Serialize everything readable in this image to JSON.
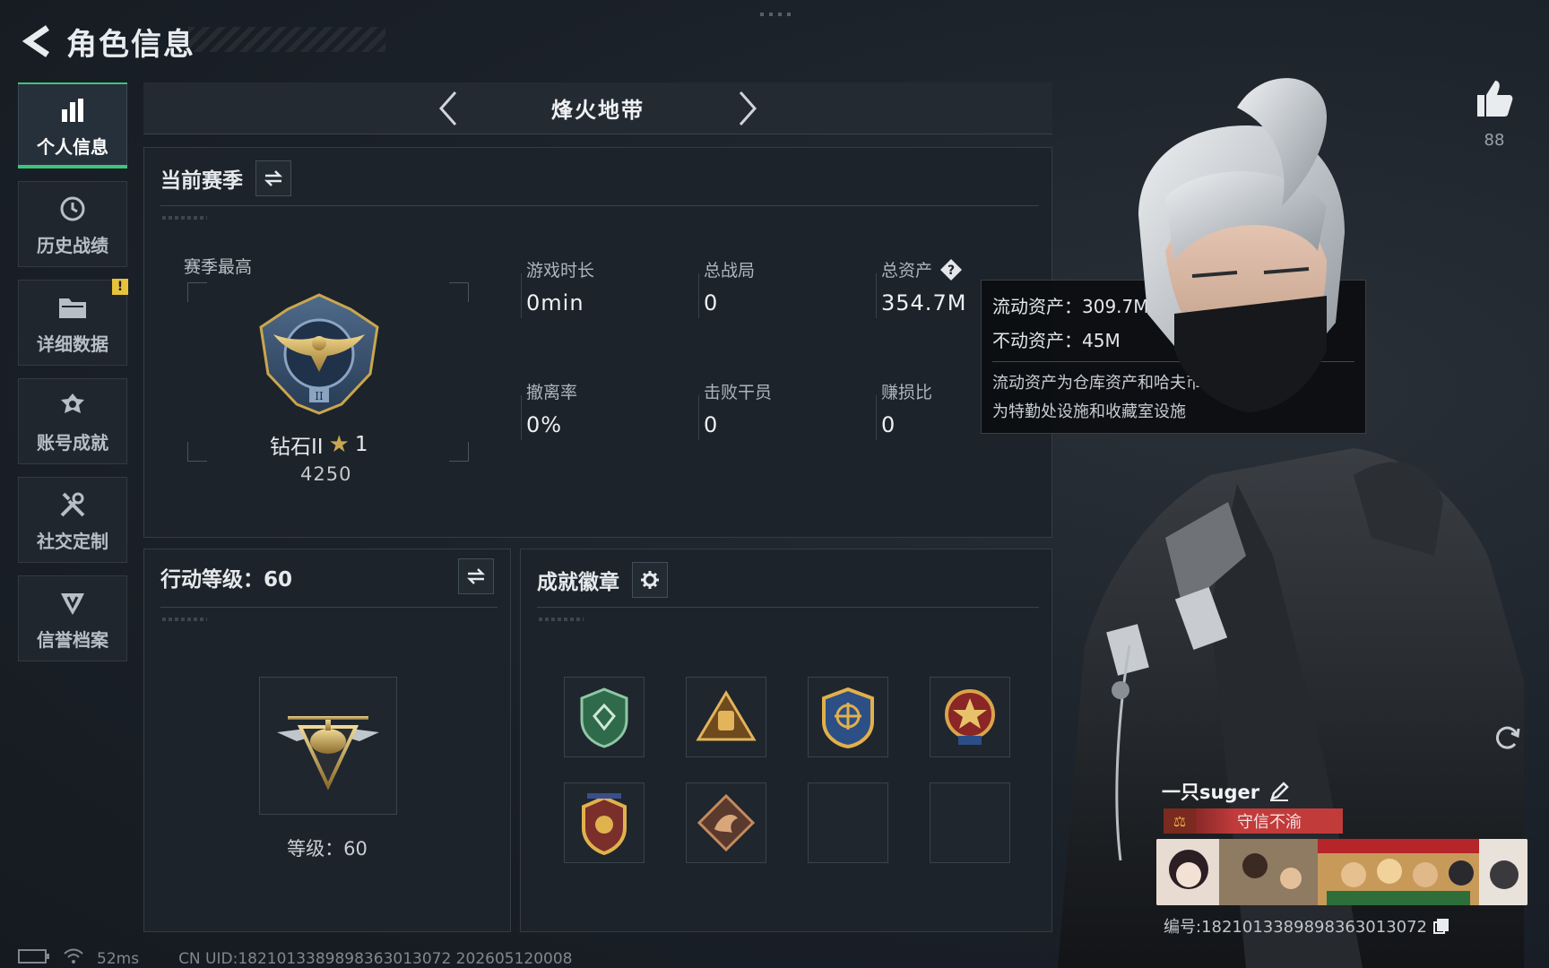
{
  "header": {
    "title": "角色信息"
  },
  "sidebar": {
    "items": [
      {
        "label": "个人信息",
        "icon": "bar-chart-icon",
        "active": true
      },
      {
        "label": "历史战绩",
        "icon": "history-icon"
      },
      {
        "label": "详细数据",
        "icon": "folder-icon",
        "badge": "!"
      },
      {
        "label": "账号成就",
        "icon": "achievement-icon"
      },
      {
        "label": "社交定制",
        "icon": "tools-icon"
      },
      {
        "label": "信誉档案",
        "icon": "credit-shield-icon"
      }
    ]
  },
  "mode": {
    "title": "烽火地带"
  },
  "season": {
    "title": "当前赛季",
    "rank_label": "赛季最高",
    "rank_name": "钻石II",
    "rank_stars": "1",
    "rank_score": "4250",
    "stats": [
      {
        "label": "游戏时长",
        "value": "0min"
      },
      {
        "label": "总战局",
        "value": "0"
      },
      {
        "label": "总资产",
        "value": "354.7M"
      },
      {
        "label": "撤离率",
        "value": "0%"
      },
      {
        "label": "击败干员",
        "value": "0"
      },
      {
        "label": "赚损比",
        "value": "0"
      }
    ]
  },
  "tooltip": {
    "liquid": "流动资产：309.7M",
    "fixed": "不动资产：45M",
    "desc_line1": "流动资产为仓库资产和哈夫币，不动资产",
    "desc_line2": "为特勤处设施和收藏室设施"
  },
  "level": {
    "title": "行动等级：60",
    "text": "等级：60"
  },
  "badges": {
    "title": "成就徽章",
    "items": [
      "green-shield-badge-icon",
      "gold-triangle-badge-icon",
      "compass-badge-icon",
      "star-medal-badge-icon",
      "winged-badge-icon",
      "dragon-badge-icon",
      "",
      ""
    ]
  },
  "character": {
    "like_count": "88"
  },
  "player": {
    "name": "一只suger",
    "title_tag": "守信不渝",
    "id": "编号:1821013389898363013072"
  },
  "status": {
    "ping": "52ms",
    "uid": "CN UID:1821013389898363013072 202605120008"
  },
  "colors": {
    "accent_green": "#3ec47c",
    "gold": "#c9a64f",
    "tag_red": "#c23b3b"
  }
}
